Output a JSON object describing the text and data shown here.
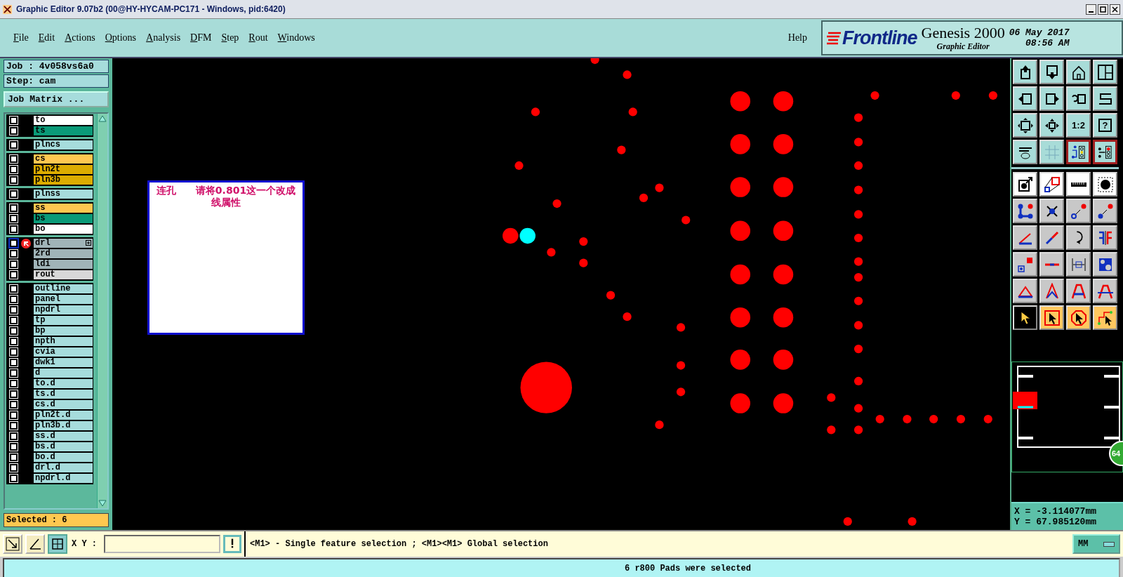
{
  "window": {
    "title": "Graphic Editor 9.07b2 (00@HY-HYCAM-PC171 - Windows, pid:6420)"
  },
  "menu": [
    "File",
    "Edit",
    "Actions",
    "Options",
    "Analysis",
    "DFM",
    "Step",
    "Rout",
    "Windows"
  ],
  "help": "Help",
  "brand": {
    "logo": "Frontline",
    "product": "Genesis 2000",
    "subtitle": "Graphic Editor",
    "date": "06 May 2017",
    "time": "08:56 AM"
  },
  "job": {
    "job": "Job : 4v058vs6a0",
    "step": "Step: cam",
    "matrix_button": "Job Matrix ..."
  },
  "layer_groups": [
    {
      "layers": [
        {
          "name": "to",
          "color": "#ffffff",
          "checked": false,
          "work_layer": false
        },
        {
          "name": "ts",
          "color": "#0a9a78",
          "checked": false,
          "work_layer": false
        }
      ]
    },
    {
      "layers": [
        {
          "name": "plncs",
          "color": "#a6dcdc",
          "checked": false,
          "work_layer": false
        }
      ]
    },
    {
      "layers": [
        {
          "name": "cs",
          "color": "#ffc850",
          "checked": false,
          "work_layer": false
        },
        {
          "name": "pln2t",
          "color": "#dcac00",
          "checked": false,
          "work_layer": false
        },
        {
          "name": "pln3b",
          "color": "#dcac00",
          "checked": false,
          "work_layer": false
        }
      ]
    },
    {
      "layers": [
        {
          "name": "plnss",
          "color": "#a6dcdc",
          "checked": false,
          "work_layer": false
        }
      ]
    },
    {
      "layers": [
        {
          "name": "ss",
          "color": "#ffc850",
          "checked": false,
          "work_layer": false
        },
        {
          "name": "bs",
          "color": "#0a9a78",
          "checked": false,
          "work_layer": false
        },
        {
          "name": "bo",
          "color": "#ffffff",
          "checked": false,
          "work_layer": false
        }
      ]
    },
    {
      "layers": [
        {
          "name": "drl",
          "color": "#a0b4b8",
          "checked": false,
          "work_layer": true
        },
        {
          "name": "2rd",
          "color": "#a0b4b8",
          "checked": false,
          "work_layer": false
        },
        {
          "name": "ldi",
          "color": "#a0b4b8",
          "checked": false,
          "work_layer": false
        },
        {
          "name": "rout",
          "color": "#d8d8d8",
          "checked": false,
          "work_layer": false
        }
      ]
    },
    {
      "layers": [
        {
          "name": "outline",
          "color": "#a6dcdc",
          "checked": false,
          "work_layer": false
        },
        {
          "name": "panel",
          "color": "#a6dcdc",
          "checked": false,
          "work_layer": false
        },
        {
          "name": "npdrl",
          "color": "#a6dcdc",
          "checked": false,
          "work_layer": false
        },
        {
          "name": "tp",
          "color": "#a6dcdc",
          "checked": false,
          "work_layer": false
        },
        {
          "name": "bp",
          "color": "#a6dcdc",
          "checked": false,
          "work_layer": false
        },
        {
          "name": "npth",
          "color": "#a6dcdc",
          "checked": false,
          "work_layer": false
        },
        {
          "name": "cvia",
          "color": "#a6dcdc",
          "checked": false,
          "work_layer": false
        },
        {
          "name": "dwk1",
          "color": "#a6dcdc",
          "checked": false,
          "work_layer": false
        },
        {
          "name": "d",
          "color": "#a6dcdc",
          "checked": false,
          "work_layer": false
        },
        {
          "name": "to.d",
          "color": "#a6dcdc",
          "checked": false,
          "work_layer": false
        },
        {
          "name": "ts.d",
          "color": "#a6dcdc",
          "checked": false,
          "work_layer": false
        },
        {
          "name": "cs.d",
          "color": "#a6dcdc",
          "checked": false,
          "work_layer": false
        },
        {
          "name": "pln2t.d",
          "color": "#a6dcdc",
          "checked": false,
          "work_layer": false
        },
        {
          "name": "pln3b.d",
          "color": "#a6dcdc",
          "checked": false,
          "work_layer": false
        },
        {
          "name": "ss.d",
          "color": "#a6dcdc",
          "checked": false,
          "work_layer": false
        },
        {
          "name": "bs.d",
          "color": "#a6dcdc",
          "checked": false,
          "work_layer": false
        },
        {
          "name": "bo.d",
          "color": "#a6dcdc",
          "checked": false,
          "work_layer": false
        },
        {
          "name": "drl.d",
          "color": "#a6dcdc",
          "checked": false,
          "work_layer": false
        },
        {
          "name": "npdrl.d",
          "color": "#a6dcdc",
          "checked": false,
          "work_layer": false
        }
      ]
    }
  ],
  "selected_count": "Selected : 6",
  "note": "连孔　　请将0.801这一个改成线属性",
  "tool_labels": {
    "scale": "1:2",
    "help": "?"
  },
  "zoom_badge": "64",
  "coords": {
    "x": "X = -3.114077mm",
    "y": "Y = 67.985120mm"
  },
  "bottom": {
    "xy_label": "X Y :",
    "prompt": "<M1> - Single feature selection ; <M1><M1> Global selection",
    "units": "MM"
  },
  "status": "6 r800 Pads were selected"
}
